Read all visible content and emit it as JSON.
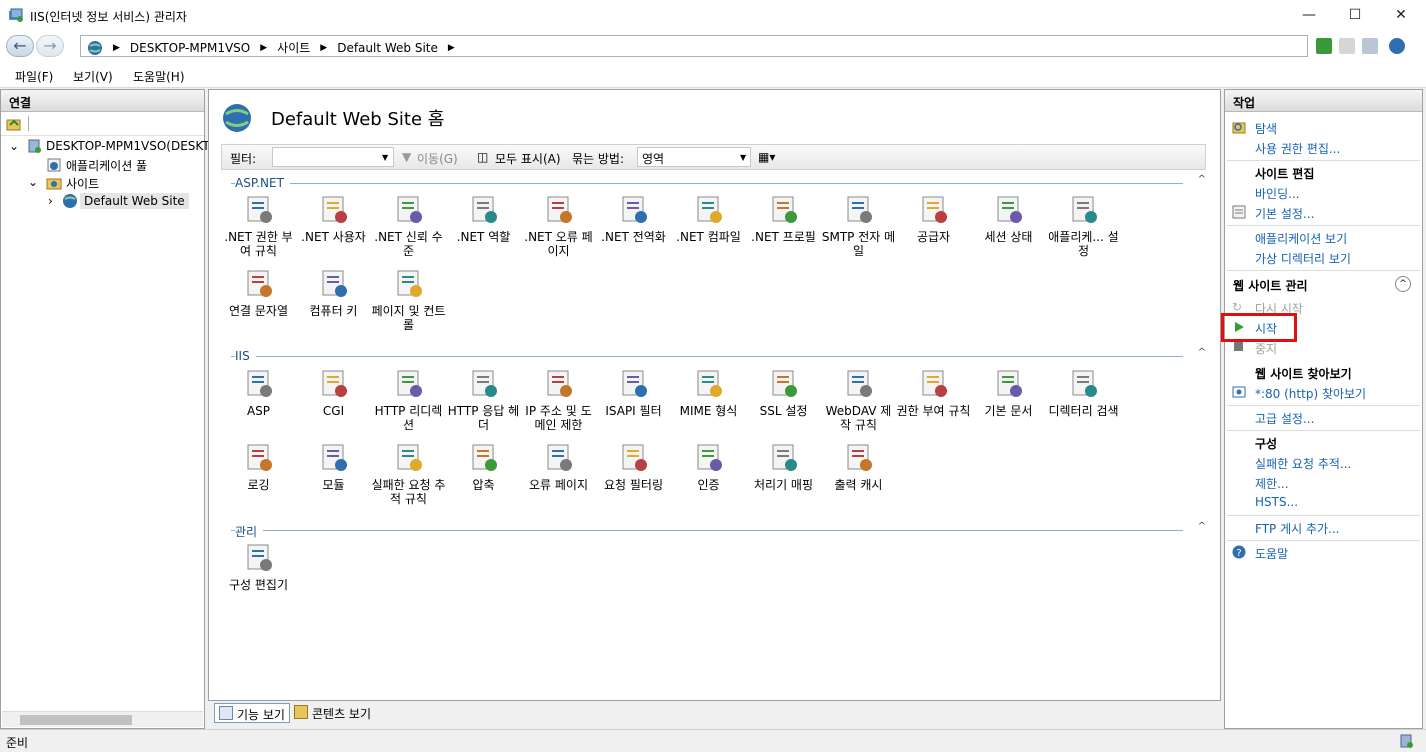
{
  "window": {
    "title": "IIS(인터넷 정보 서비스) 관리자",
    "minimize": "—",
    "maximize": "☐",
    "close": "✕"
  },
  "address": {
    "crumbs": [
      "DESKTOP-MPM1VSO",
      "사이트",
      "Default Web Site"
    ]
  },
  "menu": [
    "파일(F)",
    "보기(V)",
    "도움말(H)"
  ],
  "connections": {
    "header": "연결",
    "tree": {
      "server": "DESKTOP-MPM1VSO(DESKT",
      "app_pools": "애플리케이션 풀",
      "sites": "사이트",
      "site": "Default Web Site"
    }
  },
  "main": {
    "title": "Default Web Site 홈",
    "filter": {
      "label": "필터:",
      "go": "이동(G)",
      "show_all": "모두 표시(A)",
      "group_by_label": "묶는 방법:",
      "group_by_value": "영역"
    },
    "sections": [
      {
        "name": "ASP.NET",
        "items": [
          ".NET 권한 부여 규칙",
          ".NET 사용자",
          ".NET 신뢰 수준",
          ".NET 역할",
          ".NET 오류 페이지",
          ".NET 전역화",
          ".NET 컴파일",
          ".NET 프로필",
          "SMTP 전자 메일",
          "공급자",
          "세션 상태",
          "애플리케... 설정",
          "연결 문자열",
          "컴퓨터 키",
          "페이지 및 컨트롤"
        ]
      },
      {
        "name": "IIS",
        "items": [
          "ASP",
          "CGI",
          "HTTP 리디렉션",
          "HTTP 응답 헤더",
          "IP 주소 및 도메인 제한",
          "ISAPI 필터",
          "MIME 형식",
          "SSL 설정",
          "WebDAV 제작 규칙",
          "권한 부여 규칙",
          "기본 문서",
          "디렉터리 검색",
          "로깅",
          "모듈",
          "실패한 요청 추적 규칙",
          "압축",
          "오류 페이지",
          "요청 필터링",
          "인증",
          "처리기 매핑",
          "출력 캐시"
        ]
      },
      {
        "name": "관리",
        "items": [
          "구성 편집기"
        ]
      }
    ],
    "tabs": [
      "기능 보기",
      "콘텐츠 보기"
    ]
  },
  "actions": {
    "header": "작업",
    "explore": "탐색",
    "edit_permissions": "사용 권한 편집...",
    "edit_site_head": "사이트 편집",
    "bindings": "바인딩...",
    "basic_settings": "기본 설정...",
    "view_apps": "애플리케이션 보기",
    "view_vdirs": "가상 디렉터리 보기",
    "manage_head": "웹 사이트 관리",
    "restart": "다시 시작",
    "start": "시작",
    "stop": "중지",
    "browse_head": "웹 사이트 찾아보기",
    "browse_80": "*:80 (http) 찾아보기",
    "advanced": "고급 설정...",
    "config_head": "구성",
    "failed_tracing": "실패한 요청 추적...",
    "limits": "제한...",
    "hsts": "HSTS...",
    "ftp_publish": "FTP 게시 추가...",
    "help": "도움말"
  },
  "status": "준비",
  "colors": {
    "link": "#1662b5",
    "highlight": "#e01010"
  }
}
